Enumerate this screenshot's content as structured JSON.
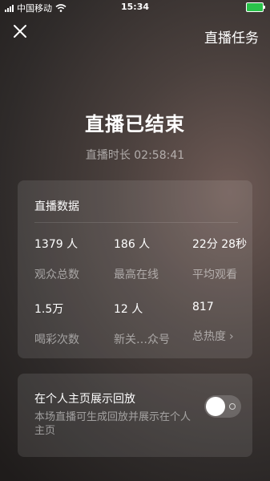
{
  "status_bar": {
    "carrier": "中国移动",
    "time": "15:34"
  },
  "header": {
    "close_icon": "close-icon",
    "task_label": "直播任务"
  },
  "summary": {
    "title": "直播已结束",
    "duration": "直播时长 02:58:41"
  },
  "stats": {
    "title": "直播数据",
    "items": [
      {
        "value": "1379 人",
        "label": "观众总数"
      },
      {
        "value": "186 人",
        "label": "最高在线"
      },
      {
        "value": "22分 28秒",
        "label": "平均观看"
      },
      {
        "value": "1.5万",
        "label": "喝彩次数"
      },
      {
        "value": "12 人",
        "label": "新关…众号"
      },
      {
        "value": "817",
        "label": "总热度"
      }
    ]
  },
  "replay": {
    "title": "在个人主页展示回放",
    "description": "本场直播可生成回放并展示在个人主页",
    "enabled": false
  }
}
